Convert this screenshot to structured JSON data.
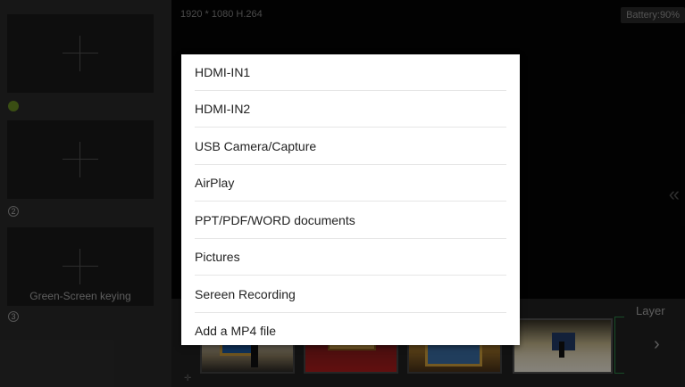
{
  "sources": {
    "slots": [
      {
        "index": "1",
        "caption": "",
        "active": true
      },
      {
        "index": "2",
        "caption": "",
        "active": false
      },
      {
        "index": "3",
        "caption": "Green-Screen keying",
        "active": false
      }
    ]
  },
  "preview": {
    "resolution": "1920 * 1080  H.264",
    "battery": "Battery:90%",
    "collapse_glyph": "«"
  },
  "layer_strip": {
    "layer_label": "Layer",
    "next_glyph": "›"
  },
  "source_menu": {
    "items": [
      "HDMI-IN1",
      "HDMI-IN2",
      "USB Camera/Capture",
      "AirPlay",
      "PPT/PDF/WORD documents",
      "Pictures",
      "Sereen Recording",
      "Add a MP4 file"
    ]
  }
}
